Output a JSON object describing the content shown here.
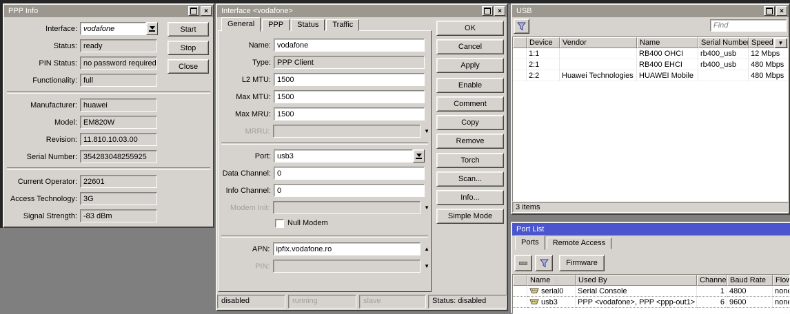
{
  "ppp_info": {
    "title": "PPP Info",
    "interface_field": {
      "label": "Interface:",
      "value": "vodafone"
    },
    "group1": [
      {
        "label": "Status:",
        "value": "ready"
      },
      {
        "label": "PIN Status:",
        "value": "no password required"
      },
      {
        "label": "Functionality:",
        "value": "full"
      }
    ],
    "group2": [
      {
        "label": "Manufacturer:",
        "value": "huawei"
      },
      {
        "label": "Model:",
        "value": "EM820W"
      },
      {
        "label": "Revision:",
        "value": "11.810.10.03.00"
      },
      {
        "label": "Serial Number:",
        "value": "354283048255925"
      }
    ],
    "group3": [
      {
        "label": "Current Operator:",
        "value": "22601"
      },
      {
        "label": "Access Technology:",
        "value": "3G"
      },
      {
        "label": "Signal Strength:",
        "value": "-83 dBm"
      }
    ],
    "buttons": [
      "Start",
      "Stop",
      "Close"
    ]
  },
  "interface_window": {
    "title": "Interface <vodafone>",
    "tabs": [
      "General",
      "PPP",
      "Status",
      "Traffic"
    ],
    "active_tab": "General",
    "fields": {
      "name": {
        "label": "Name:",
        "value": "vodafone"
      },
      "type": {
        "label": "Type:",
        "value": "PPP Client"
      },
      "l2_mtu": {
        "label": "L2 MTU:",
        "value": "1500"
      },
      "max_mtu": {
        "label": "Max MTU:",
        "value": "1500"
      },
      "max_mru": {
        "label": "Max MRU:",
        "value": "1500"
      },
      "mrru": {
        "label": "MRRU:",
        "value": ""
      },
      "port": {
        "label": "Port:",
        "value": "usb3"
      },
      "data_channel": {
        "label": "Data Channel:",
        "value": "0"
      },
      "info_channel": {
        "label": "Info Channel:",
        "value": "0"
      },
      "modem_init": {
        "label": "Modem Init:",
        "value": ""
      },
      "null_modem": {
        "label": "Null Modem",
        "checked": false
      },
      "apn": {
        "label": "APN:",
        "value": "ipfix.vodafone.ro"
      },
      "pin": {
        "label": "PIN:",
        "value": ""
      }
    },
    "button_groups": [
      [
        "OK",
        "Cancel",
        "Apply"
      ],
      [
        "Enable",
        "Comment",
        "Copy",
        "Remove"
      ],
      [
        "Torch",
        "Scan...",
        "Info...",
        "Simple Mode"
      ]
    ],
    "status_bar": {
      "flags": [
        {
          "text": "disabled",
          "active": true
        },
        {
          "text": "running",
          "active": false
        },
        {
          "text": "slave",
          "active": false
        }
      ],
      "status": "Status: disabled"
    }
  },
  "usb_window": {
    "title": "USB",
    "find_placeholder": "Find",
    "status": "3 items",
    "table": {
      "columns": [
        "Device",
        "Vendor",
        "Name",
        "Serial Number",
        "Speed"
      ],
      "rows": [
        [
          "1:1",
          "",
          "RB400 OHCI",
          "rb400_usb",
          "12 Mbps"
        ],
        [
          "2:1",
          "",
          "RB400 EHCI",
          "rb400_usb",
          "480 Mbps"
        ],
        [
          "2:2",
          "Huawei Technologies",
          "HUAWEI Mobile",
          "",
          "480 Mbps"
        ]
      ]
    }
  },
  "port_list_window": {
    "title": "Port List",
    "tabs": [
      "Ports",
      "Remote Access"
    ],
    "active_tab": "Ports",
    "firmware_label": "Firmware",
    "table": {
      "columns": [
        "Name",
        "Used By",
        "Channels",
        "Baud Rate",
        "Flow"
      ],
      "rows": [
        [
          "serial0",
          "Serial Console",
          "1",
          "4800",
          "none"
        ],
        [
          "usb3",
          "PPP <vodafone>, PPP <ppp-out1>",
          "6",
          "9600",
          "none"
        ]
      ]
    }
  }
}
